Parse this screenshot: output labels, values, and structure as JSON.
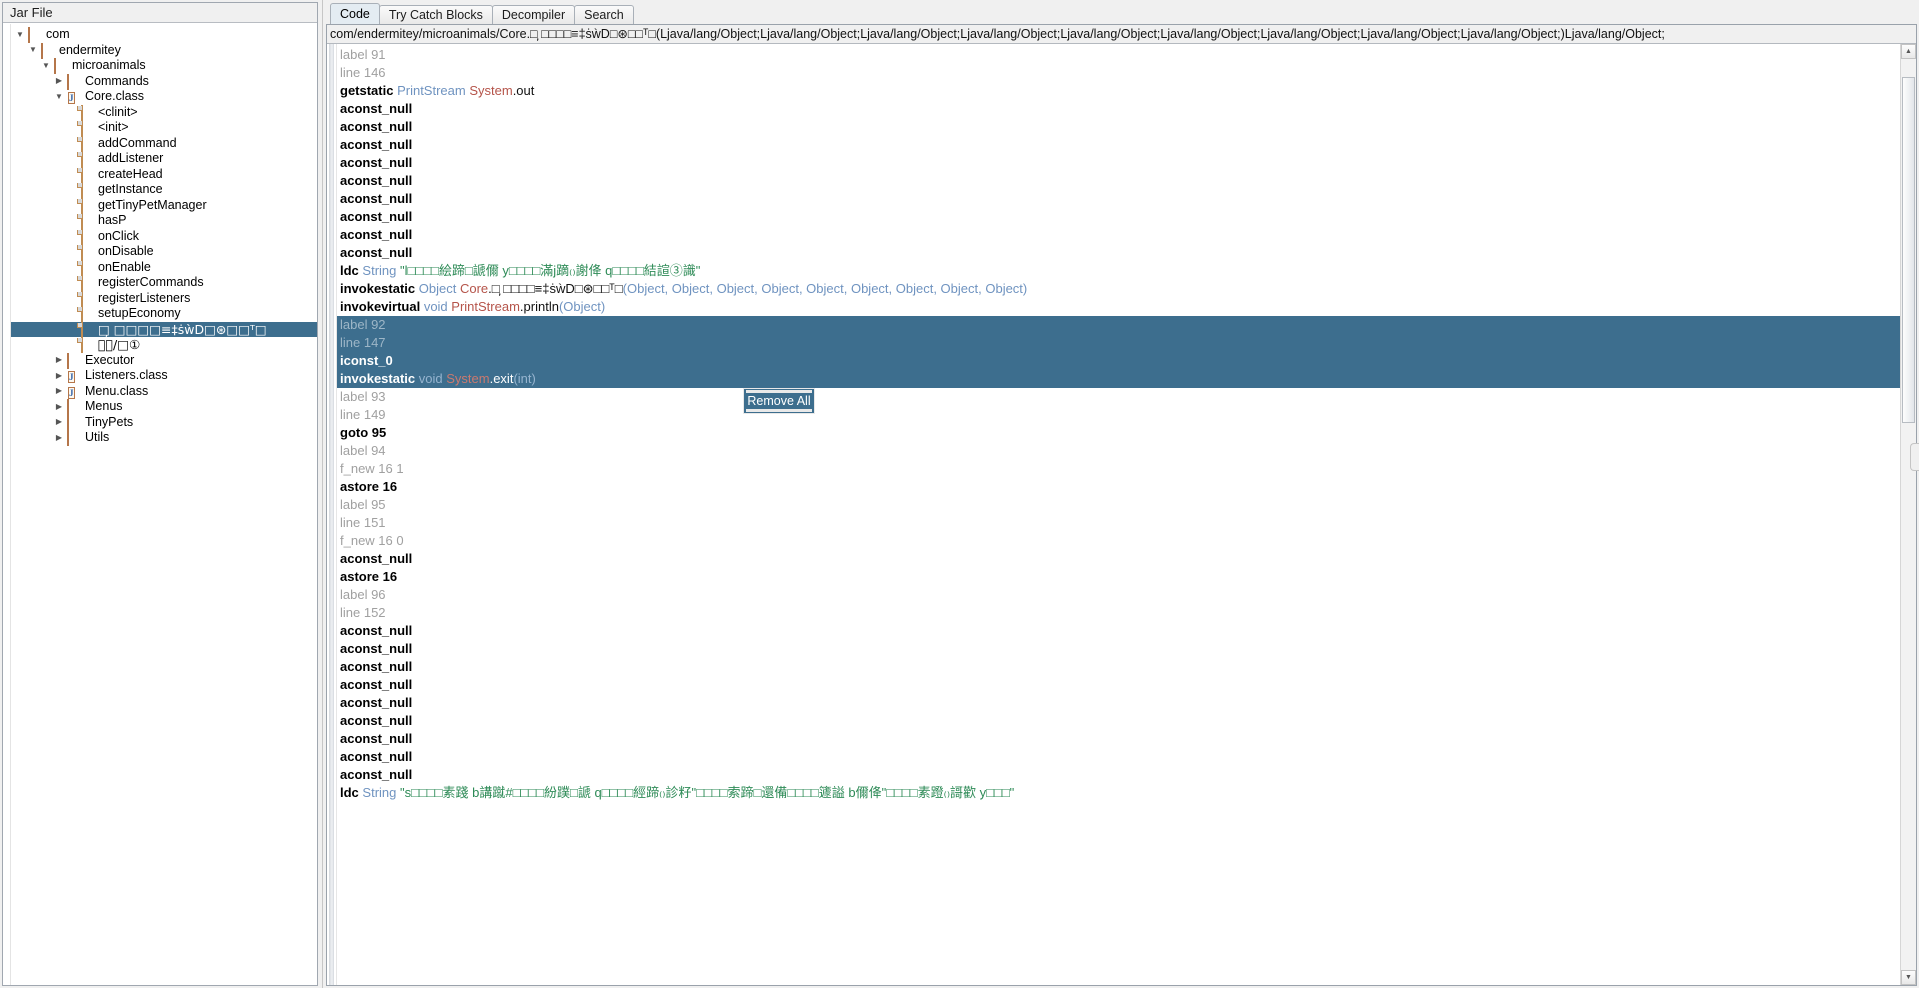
{
  "left_panel": {
    "title": "Jar File",
    "tree": [
      {
        "depth": 0,
        "twisty": "down",
        "icon": "package-icon",
        "label": "com"
      },
      {
        "depth": 1,
        "twisty": "down",
        "icon": "package-icon",
        "label": "endermitey"
      },
      {
        "depth": 2,
        "twisty": "down",
        "icon": "package-icon",
        "label": "microanimals"
      },
      {
        "depth": 3,
        "twisty": "right",
        "icon": "package-icon",
        "label": "Commands"
      },
      {
        "depth": 3,
        "twisty": "down",
        "icon": "class-icon",
        "label": "Core.class"
      },
      {
        "depth": 4,
        "twisty": "none",
        "icon": "method-icon",
        "label": "<clinit>"
      },
      {
        "depth": 4,
        "twisty": "none",
        "icon": "method-icon",
        "label": "<init>"
      },
      {
        "depth": 4,
        "twisty": "none",
        "icon": "method-icon",
        "label": "addCommand"
      },
      {
        "depth": 4,
        "twisty": "none",
        "icon": "method-icon",
        "label": "addListener"
      },
      {
        "depth": 4,
        "twisty": "none",
        "icon": "method-icon",
        "label": "createHead"
      },
      {
        "depth": 4,
        "twisty": "none",
        "icon": "method-icon",
        "label": "getInstance"
      },
      {
        "depth": 4,
        "twisty": "none",
        "icon": "method-icon",
        "label": "getTinyPetManager"
      },
      {
        "depth": 4,
        "twisty": "none",
        "icon": "method-icon",
        "label": "hasP"
      },
      {
        "depth": 4,
        "twisty": "none",
        "icon": "method-icon",
        "label": "onClick"
      },
      {
        "depth": 4,
        "twisty": "none",
        "icon": "method-icon",
        "label": "onDisable"
      },
      {
        "depth": 4,
        "twisty": "none",
        "icon": "method-icon",
        "label": "onEnable"
      },
      {
        "depth": 4,
        "twisty": "none",
        "icon": "method-icon",
        "label": "registerCommands"
      },
      {
        "depth": 4,
        "twisty": "none",
        "icon": "method-icon",
        "label": "registerListeners"
      },
      {
        "depth": 4,
        "twisty": "none",
        "icon": "method-icon",
        "label": "setupEconomy"
      },
      {
        "depth": 4,
        "twisty": "none",
        "icon": "method-icon",
        "label": "□̦̦  □□□□≡‡ṡẁD□⊛□□ᵀ□",
        "selected": true
      },
      {
        "depth": 4,
        "twisty": "none",
        "icon": "method-icon",
        "label": "⒫ྤ/□①"
      },
      {
        "depth": 3,
        "twisty": "right",
        "icon": "package-icon",
        "label": "Executor"
      },
      {
        "depth": 3,
        "twisty": "right",
        "icon": "class-icon",
        "label": "Listeners.class"
      },
      {
        "depth": 3,
        "twisty": "right",
        "icon": "class-icon",
        "label": "Menu.class"
      },
      {
        "depth": 3,
        "twisty": "right",
        "icon": "package-icon",
        "label": "Menus"
      },
      {
        "depth": 3,
        "twisty": "right",
        "icon": "package-icon",
        "label": "TinyPets"
      },
      {
        "depth": 3,
        "twisty": "right",
        "icon": "package-icon",
        "label": "Utils"
      }
    ]
  },
  "right_panel": {
    "tabs": [
      {
        "label": "Code",
        "active": true
      },
      {
        "label": "Try Catch Blocks",
        "active": false
      },
      {
        "label": "Decompiler",
        "active": false
      },
      {
        "label": "Search",
        "active": false
      }
    ],
    "signature": "com/endermitey/microanimals/Core.□̦̦  □□□□≡‡ṡẁD□⊛□□ᵀ□(Ljava/lang/Object;Ljava/lang/Object;Ljava/lang/Object;Ljava/lang/Object;Ljava/lang/Object;Ljava/lang/Object;Ljava/lang/Object;Ljava/lang/Object;Ljava/lang/Object;)Ljava/lang/Object;",
    "code_lines": [
      {
        "selected": false,
        "tokens": [
          {
            "c": "meta",
            "t": "label 91"
          }
        ]
      },
      {
        "selected": false,
        "tokens": [
          {
            "c": "meta",
            "t": "line 146"
          }
        ]
      },
      {
        "selected": false,
        "tokens": [
          {
            "c": "op",
            "t": "getstatic"
          },
          {
            "c": "type",
            "t": " PrintStream"
          },
          {
            "c": "owner",
            "t": " System"
          },
          {
            "c": "plain",
            "t": ".out"
          }
        ]
      },
      {
        "selected": false,
        "tokens": [
          {
            "c": "op",
            "t": "aconst_null"
          }
        ]
      },
      {
        "selected": false,
        "tokens": [
          {
            "c": "op",
            "t": "aconst_null"
          }
        ]
      },
      {
        "selected": false,
        "tokens": [
          {
            "c": "op",
            "t": "aconst_null"
          }
        ]
      },
      {
        "selected": false,
        "tokens": [
          {
            "c": "op",
            "t": "aconst_null"
          }
        ]
      },
      {
        "selected": false,
        "tokens": [
          {
            "c": "op",
            "t": "aconst_null"
          }
        ]
      },
      {
        "selected": false,
        "tokens": [
          {
            "c": "op",
            "t": "aconst_null"
          }
        ]
      },
      {
        "selected": false,
        "tokens": [
          {
            "c": "op",
            "t": "aconst_null"
          }
        ]
      },
      {
        "selected": false,
        "tokens": [
          {
            "c": "op",
            "t": "aconst_null"
          }
        ]
      },
      {
        "selected": false,
        "tokens": [
          {
            "c": "op",
            "t": "aconst_null"
          }
        ]
      },
      {
        "selected": false,
        "tokens": [
          {
            "c": "op",
            "t": "ldc"
          },
          {
            "c": "type",
            "t": " String"
          },
          {
            "c": "str",
            "t": " \"l□□□□絵蹄□謕儞 y□□□□滿j蹢₍₎謝佭 q□□□□結諠③識\""
          }
        ]
      },
      {
        "selected": false,
        "tokens": [
          {
            "c": "op",
            "t": "invokestatic"
          },
          {
            "c": "type",
            "t": " Object"
          },
          {
            "c": "owner",
            "t": " Core"
          },
          {
            "c": "plain",
            "t": ".□̦̦  □□□□≡‡ṡẁD□⊛□□ᵀ□"
          },
          {
            "c": "arg",
            "t": "(Object, Object, Object, Object, Object, Object, Object, Object, Object)"
          }
        ]
      },
      {
        "selected": false,
        "tokens": [
          {
            "c": "op",
            "t": "invokevirtual"
          },
          {
            "c": "type",
            "t": " void"
          },
          {
            "c": "owner",
            "t": " PrintStream"
          },
          {
            "c": "plain",
            "t": ".println"
          },
          {
            "c": "arg",
            "t": "(Object)"
          }
        ]
      },
      {
        "selected": true,
        "tokens": [
          {
            "c": "meta",
            "t": "label 92"
          }
        ]
      },
      {
        "selected": true,
        "tokens": [
          {
            "c": "meta",
            "t": "line 147"
          }
        ]
      },
      {
        "selected": true,
        "tokens": [
          {
            "c": "op",
            "t": "iconst_0"
          }
        ]
      },
      {
        "selected": true,
        "tokens": [
          {
            "c": "op",
            "t": "invokestatic"
          },
          {
            "c": "type",
            "t": " void"
          },
          {
            "c": "owner",
            "t": " System"
          },
          {
            "c": "plain",
            "t": ".exit"
          },
          {
            "c": "arg",
            "t": "(int)"
          }
        ]
      },
      {
        "selected": false,
        "tokens": [
          {
            "c": "meta",
            "t": "label 93"
          }
        ]
      },
      {
        "selected": false,
        "tokens": [
          {
            "c": "meta",
            "t": "line 149"
          }
        ]
      },
      {
        "selected": false,
        "tokens": [
          {
            "c": "op",
            "t": "goto 95"
          }
        ]
      },
      {
        "selected": false,
        "tokens": [
          {
            "c": "meta",
            "t": "label 94"
          }
        ]
      },
      {
        "selected": false,
        "tokens": [
          {
            "c": "meta",
            "t": "f_new 16 1"
          }
        ]
      },
      {
        "selected": false,
        "tokens": [
          {
            "c": "op",
            "t": "astore 16"
          }
        ]
      },
      {
        "selected": false,
        "tokens": [
          {
            "c": "meta",
            "t": "label 95"
          }
        ]
      },
      {
        "selected": false,
        "tokens": [
          {
            "c": "meta",
            "t": "line 151"
          }
        ]
      },
      {
        "selected": false,
        "tokens": [
          {
            "c": "meta",
            "t": "f_new 16 0"
          }
        ]
      },
      {
        "selected": false,
        "tokens": [
          {
            "c": "op",
            "t": "aconst_null"
          }
        ]
      },
      {
        "selected": false,
        "tokens": [
          {
            "c": "op",
            "t": "astore 16"
          }
        ]
      },
      {
        "selected": false,
        "tokens": [
          {
            "c": "meta",
            "t": "label 96"
          }
        ]
      },
      {
        "selected": false,
        "tokens": [
          {
            "c": "meta",
            "t": "line 152"
          }
        ]
      },
      {
        "selected": false,
        "tokens": [
          {
            "c": "op",
            "t": "aconst_null"
          }
        ]
      },
      {
        "selected": false,
        "tokens": [
          {
            "c": "op",
            "t": "aconst_null"
          }
        ]
      },
      {
        "selected": false,
        "tokens": [
          {
            "c": "op",
            "t": "aconst_null"
          }
        ]
      },
      {
        "selected": false,
        "tokens": [
          {
            "c": "op",
            "t": "aconst_null"
          }
        ]
      },
      {
        "selected": false,
        "tokens": [
          {
            "c": "op",
            "t": "aconst_null"
          }
        ]
      },
      {
        "selected": false,
        "tokens": [
          {
            "c": "op",
            "t": "aconst_null"
          }
        ]
      },
      {
        "selected": false,
        "tokens": [
          {
            "c": "op",
            "t": "aconst_null"
          }
        ]
      },
      {
        "selected": false,
        "tokens": [
          {
            "c": "op",
            "t": "aconst_null"
          }
        ]
      },
      {
        "selected": false,
        "tokens": [
          {
            "c": "op",
            "t": "aconst_null"
          }
        ]
      },
      {
        "selected": false,
        "tokens": [
          {
            "c": "op",
            "t": "ldc"
          },
          {
            "c": "type",
            "t": " String"
          },
          {
            "c": "str",
            "t": " \"s□□□□素踐 b講蹴#□□□□紛蹼□謕 q□□□□經蹄₍₎診籽\"□□□□索蹄□還備□□□□籧謚 b儞佭\"□□□□素蹬₍₎謌歡 y□□□\""
          }
        ]
      }
    ]
  },
  "popup": {
    "label": "Remove All"
  },
  "colors": {
    "selection": "#3d6e8e",
    "panel_bg": "#f0f0f0",
    "editor_bg": "#ffffff",
    "string_green": "#2e8b57",
    "type_blue": "#6f93c0",
    "owner_red": "#b5544a"
  }
}
